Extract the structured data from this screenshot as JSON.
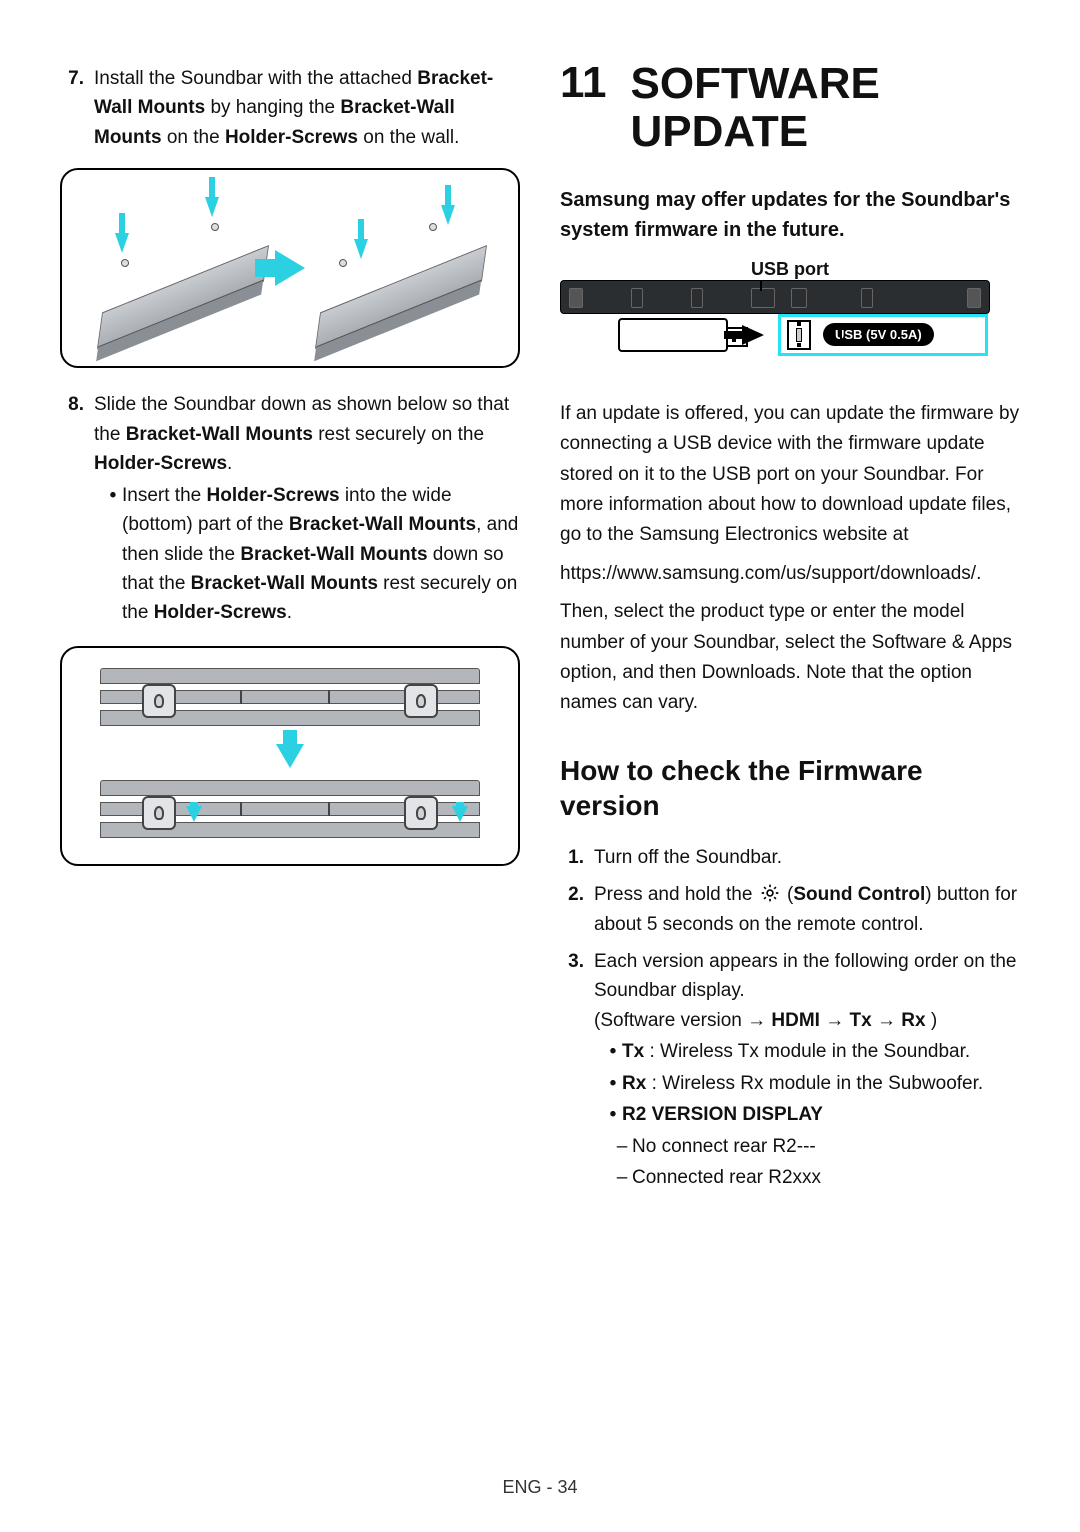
{
  "left": {
    "step7": {
      "num": "7.",
      "pre": "Install the Soundbar with the attached ",
      "b1": "Bracket-Wall Mounts",
      "mid1": " by hanging the ",
      "b2": "Bracket-Wall Mounts",
      "mid2": " on the ",
      "b3": "Holder-Screws",
      "post": " on the wall."
    },
    "step8": {
      "num": "8.",
      "pre": "Slide the Soundbar down as shown below so that the ",
      "b1": "Bracket-Wall Mounts",
      "mid": " rest securely on the ",
      "b2": "Holder-Screws",
      "post": "."
    },
    "step8_bullet": {
      "pre": "Insert the ",
      "b1": "Holder-Screws",
      "mid1": " into the wide (bottom) part of the ",
      "b2": "Bracket-Wall Mounts",
      "mid2": ", and then slide the ",
      "b3": "Bracket-Wall Mounts",
      "mid3": " down so that the ",
      "b4": "Bracket-Wall Mounts",
      "mid4": " rest securely on the ",
      "b5": "Holder-Screws",
      "post": "."
    }
  },
  "right": {
    "chapter_num": "11",
    "chapter_title": "SOFTWARE UPDATE",
    "intro": "Samsung may offer updates for the Soundbar's system firmware in the future.",
    "usb_port_label": "USB port",
    "usb_badge": "USB (5V 0.5A)",
    "para1": "If an update is offered, you can update the firmware by connecting a USB device with the firmware update stored on it to the USB port on your Soundbar. For more information about how to download update files, go to the Samsung Electronics website at",
    "para_url": "https://www.samsung.com/us/support/downloads/.",
    "para2": "Then, select the product type or enter the model number of your Soundbar, select the Software & Apps option, and then Downloads. Note that the option names can vary.",
    "h2": "How to check the Firmware version",
    "fw1": {
      "num": "1.",
      "text": "Turn off the Soundbar."
    },
    "fw2": {
      "num": "2.",
      "pre": "Press and hold the ",
      "icon_aria": "gear",
      "paren_pre": " (",
      "b1": "Sound Control",
      "paren_post": ") button for about 5 seconds on the remote control."
    },
    "fw3": {
      "num": "3.",
      "line1": "Each version appears in the following order on the Soundbar display.",
      "seq_pre": "(Software version ",
      "seq_b1": "HDMI",
      "seq_b2": "Tx",
      "seq_b3": "Rx",
      "seq_post": " )",
      "arrow": "→",
      "bullet_tx_b": "Tx",
      "bullet_tx_rest": " : Wireless Tx module in the Soundbar.",
      "bullet_rx_b": "Rx",
      "bullet_rx_rest": " : Wireless Rx module in the Subwoofer.",
      "bullet_r2": "R2 VERSION DISPLAY",
      "dash1": "No connect rear R2---",
      "dash2": "Connected rear R2xxx"
    }
  },
  "footer": "ENG - 34"
}
